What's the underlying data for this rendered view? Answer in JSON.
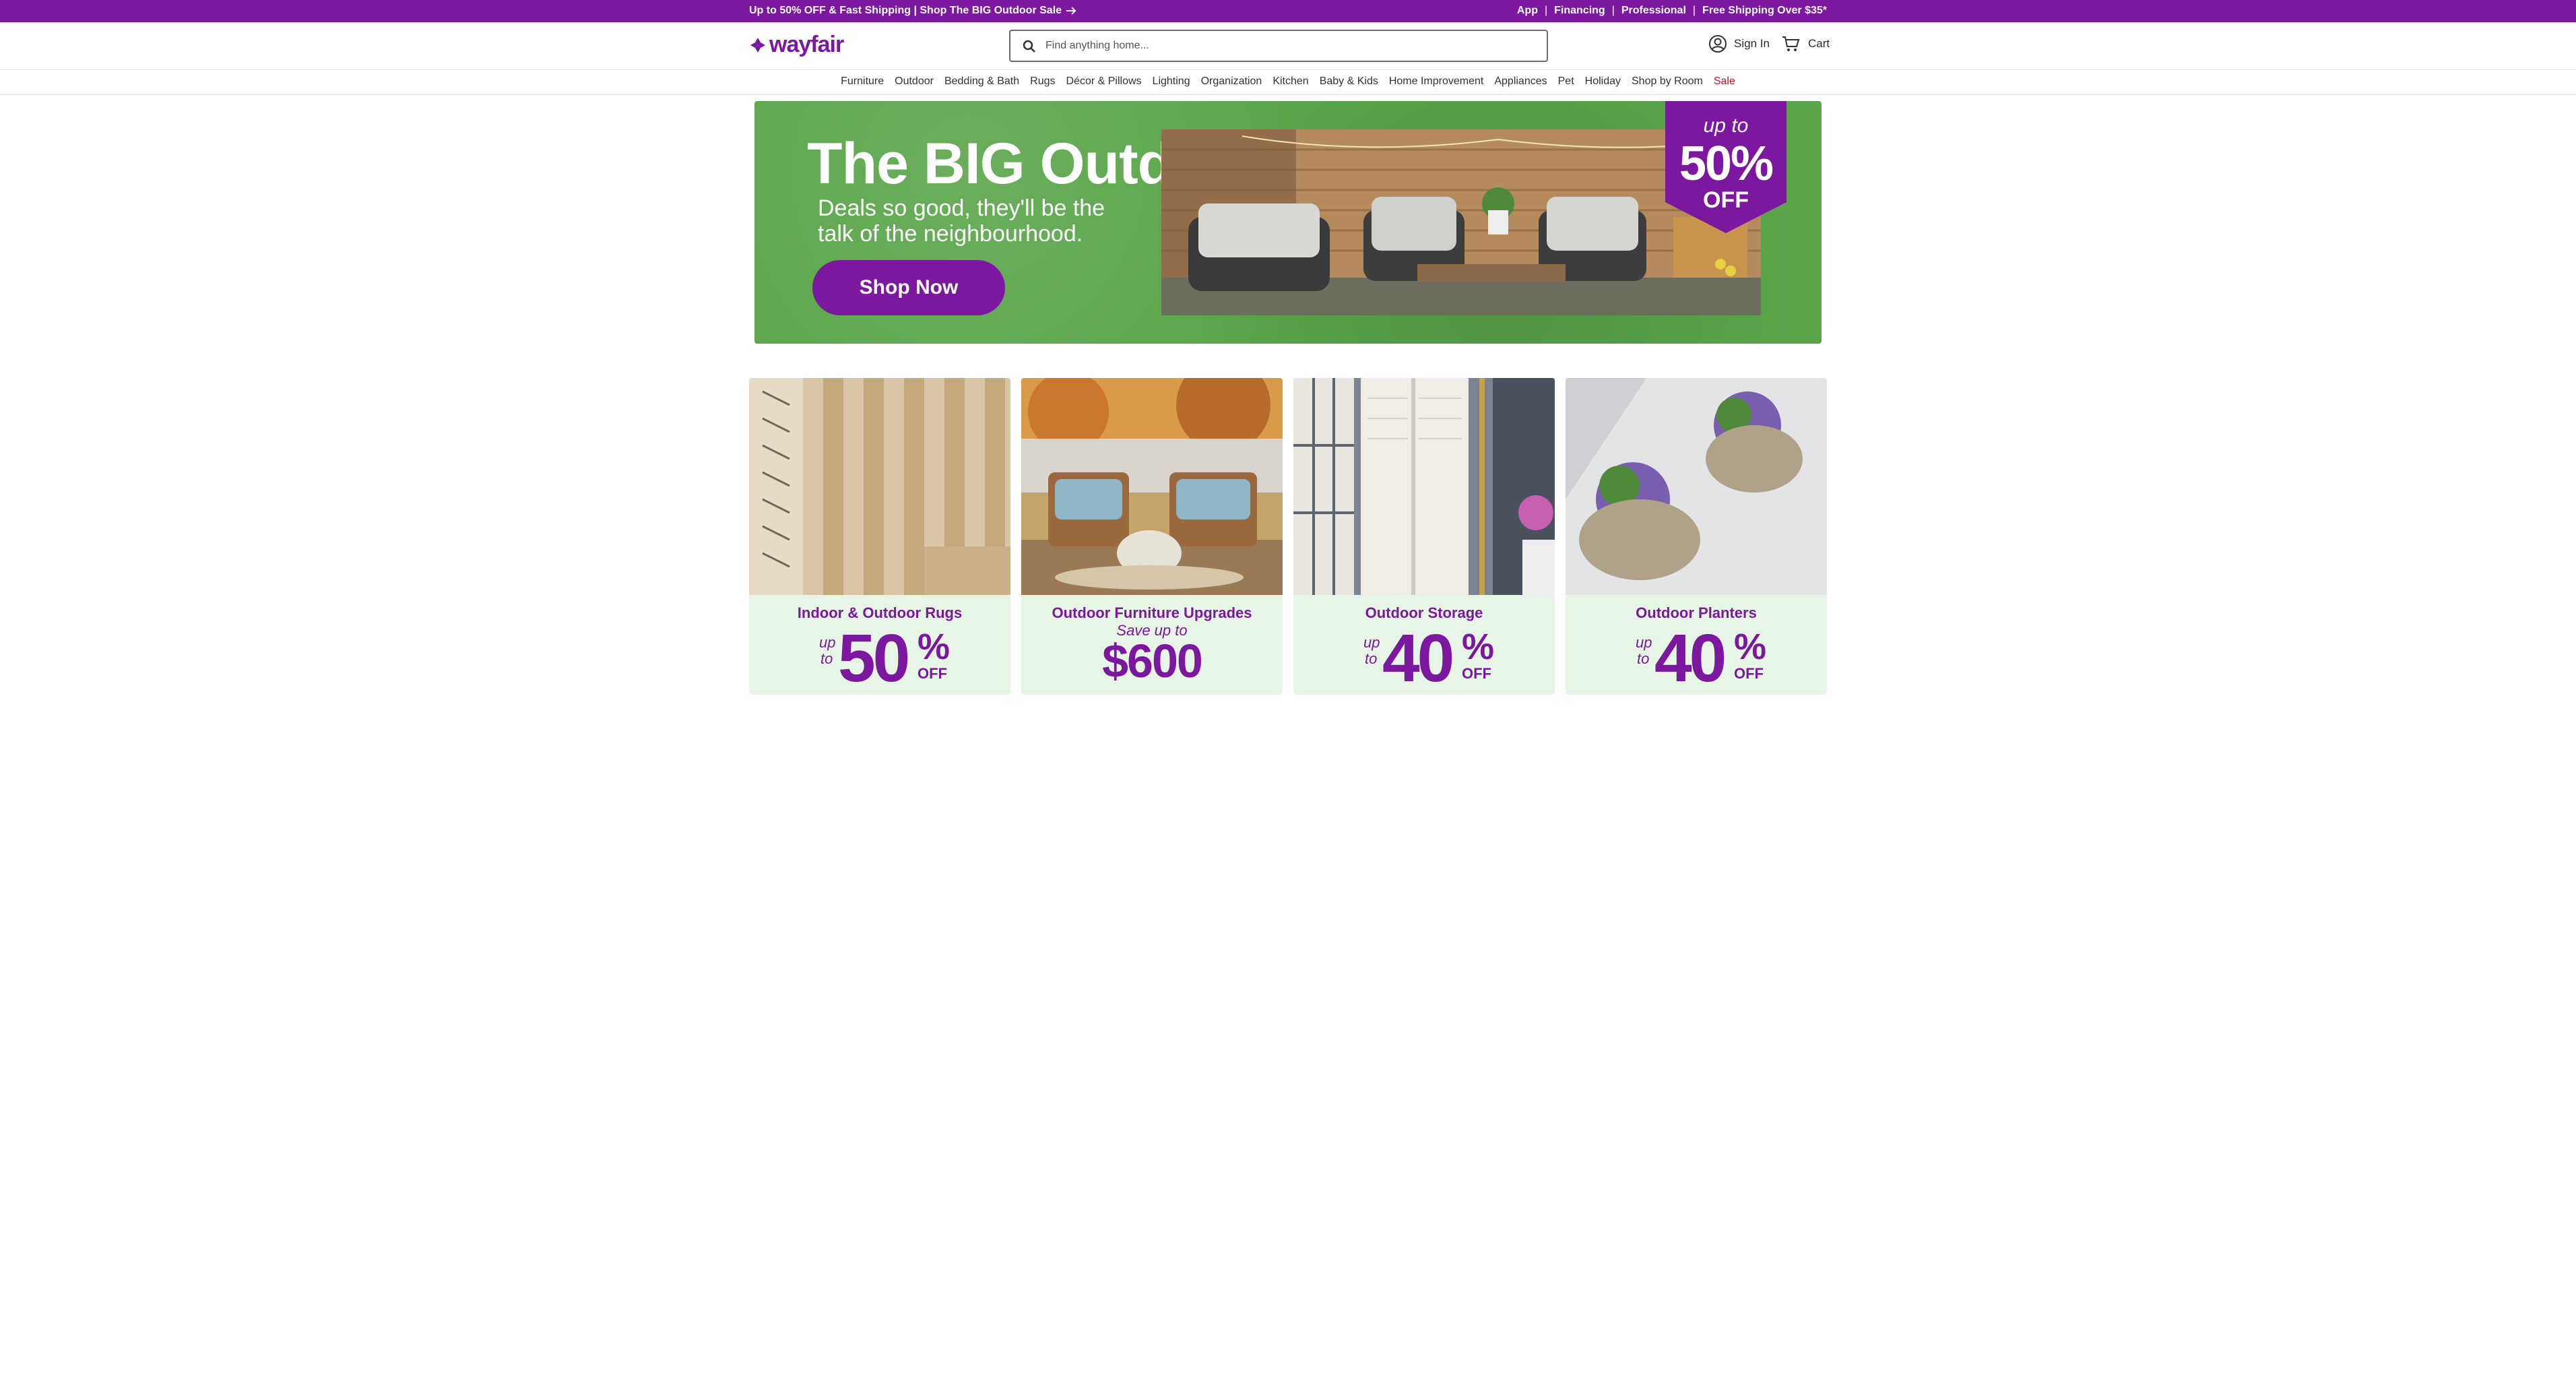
{
  "colors": {
    "brand": "#7b189f",
    "sale": "#c8102e",
    "hero_bg": "#5aa54a",
    "card_bg": "#e6f5e6"
  },
  "promo": {
    "left_text": "Up to 50% OFF & Fast Shipping | Shop The BIG Outdoor Sale",
    "arrow_icon": "arrow-right-icon",
    "links": [
      "App",
      "Financing",
      "Professional",
      "Free Shipping Over $35*"
    ]
  },
  "header": {
    "logo_text": "wayfair",
    "search_placeholder": "Find anything home...",
    "sign_in_label": "Sign In",
    "cart_label": "Cart"
  },
  "nav": {
    "items": [
      "Furniture",
      "Outdoor",
      "Bedding & Bath",
      "Rugs",
      "Décor & Pillows",
      "Lighting",
      "Organization",
      "Kitchen",
      "Baby & Kids",
      "Home Improvement",
      "Appliances",
      "Pet",
      "Holiday",
      "Shop by Room",
      "Sale"
    ]
  },
  "hero": {
    "title": "The BIG Outdoor Sale",
    "subtitle_line1": "Deals so good, they'll be the",
    "subtitle_line2": "talk of the neighbourhood.",
    "cta_label": "Shop Now",
    "badge_up_to": "up to",
    "badge_percent": "50%",
    "badge_off": "OFF"
  },
  "cards": [
    {
      "title": "Indoor & Outdoor Rugs",
      "up": "up",
      "to": "to",
      "number": "50",
      "pct": "%",
      "off": "OFF"
    },
    {
      "title": "Outdoor Furniture Upgrades",
      "save": "Save up to",
      "amount": "$600"
    },
    {
      "title": "Outdoor Storage",
      "up": "up",
      "to": "to",
      "number": "40",
      "pct": "%",
      "off": "OFF"
    },
    {
      "title": "Outdoor Planters",
      "up": "up",
      "to": "to",
      "number": "40",
      "pct": "%",
      "off": "OFF"
    }
  ]
}
